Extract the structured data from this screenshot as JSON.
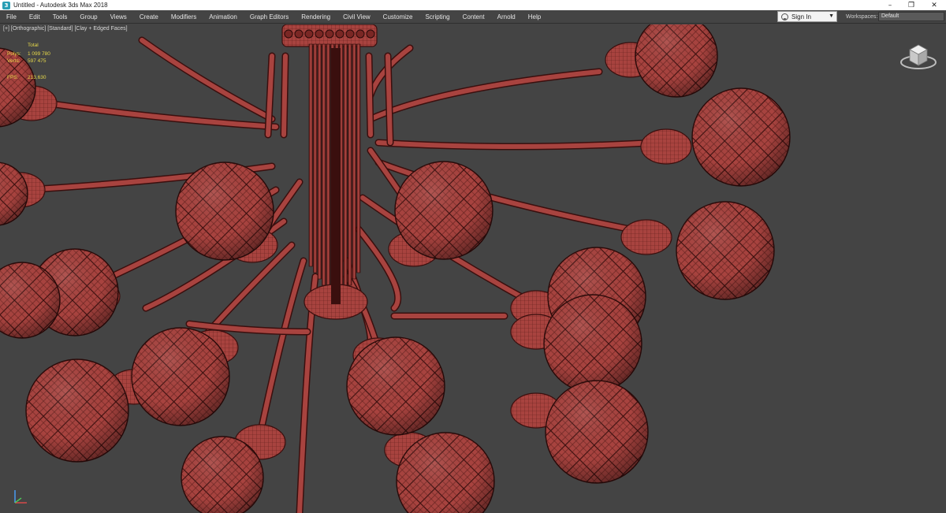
{
  "window": {
    "title": "Untitled - Autodesk 3ds Max 2018",
    "minimize": "–",
    "maximize": "❐",
    "close": "✕"
  },
  "menu": [
    "File",
    "Edit",
    "Tools",
    "Group",
    "Views",
    "Create",
    "Modifiers",
    "Animation",
    "Graph Editors",
    "Rendering",
    "Civil View",
    "Customize",
    "Scripting",
    "Content",
    "Arnold",
    "Help"
  ],
  "account": {
    "signin_label": "Sign In"
  },
  "workspaces": {
    "label": "Workspaces:",
    "value": "Default"
  },
  "viewport": {
    "label": "[+] [Orthographic] [Standard] [Clay + Edged Faces]",
    "stats": {
      "total_label": "Total",
      "polys_label": "Polys:",
      "polys_value": "1 099 780",
      "verts_label": "Verts:",
      "verts_value": "597 475",
      "fps_label": "FPS:",
      "fps_value": "213,630"
    },
    "colors": {
      "background": "#444444",
      "model_fill": "#a8433f",
      "wire": "#3a0f0e",
      "stats_text": "#e6d84a"
    }
  }
}
